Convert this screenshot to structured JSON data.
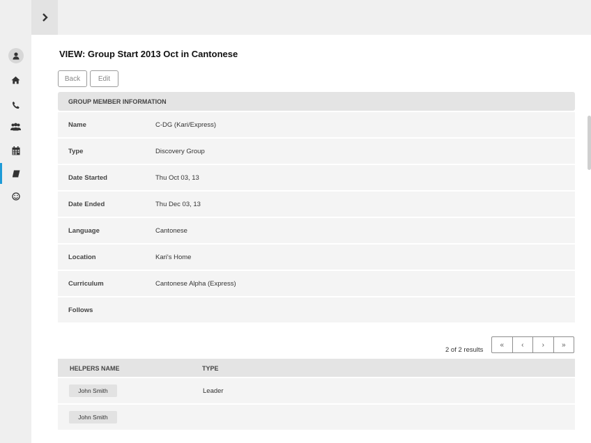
{
  "sidebar": {
    "items": [
      {
        "icon": "user-icon"
      },
      {
        "icon": "home-icon"
      },
      {
        "icon": "phone-icon"
      },
      {
        "icon": "users-icon"
      },
      {
        "icon": "calendar-icon"
      },
      {
        "icon": "book-icon",
        "active": true
      },
      {
        "icon": "smiley-icon"
      }
    ],
    "accent_color": "#1e9bd7"
  },
  "topbar": {
    "toggle_icon": "chevron-right-icon"
  },
  "page": {
    "title": "VIEW: Group Start 2013 Oct in Cantonese",
    "back_label": "Back",
    "edit_label": "Edit"
  },
  "info": {
    "header": "GROUP MEMBER INFORMATION",
    "rows": [
      {
        "label": "Name",
        "value": "C-DG (Kari/Express)"
      },
      {
        "label": "Type",
        "value": "Discovery Group"
      },
      {
        "label": "Date Started",
        "value": "Thu Oct 03, 13"
      },
      {
        "label": "Date Ended",
        "value": "Thu Dec 03, 13"
      },
      {
        "label": "Language",
        "value": "Cantonese"
      },
      {
        "label": "Location",
        "value": "Kari's Home"
      },
      {
        "label": "Curriculum",
        "value": "Cantonese Alpha (Express)"
      },
      {
        "label": "Follows",
        "value": ""
      }
    ]
  },
  "pagination": {
    "results_text": "2 of 2 results",
    "first": "«",
    "prev": "‹",
    "next": "›",
    "last": "»"
  },
  "helpers": {
    "columns": [
      "HELPERS NAME",
      "TYPE"
    ],
    "rows": [
      {
        "name": "John Smith",
        "type": "Leader"
      },
      {
        "name": "John Smith",
        "type": ""
      }
    ]
  }
}
